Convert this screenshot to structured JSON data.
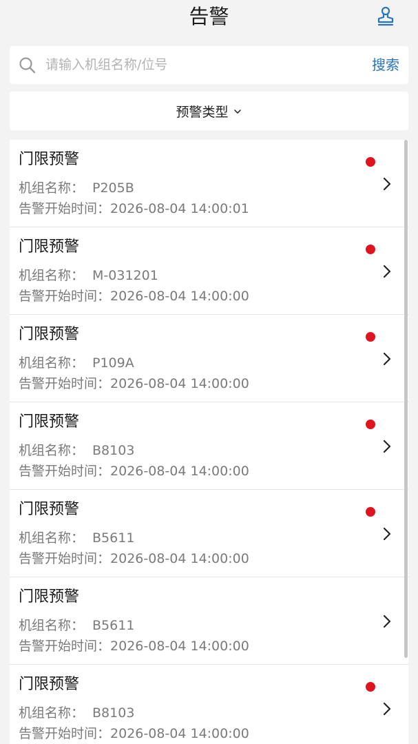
{
  "header": {
    "title": "告警",
    "stamp_icon": "stamp-icon"
  },
  "search": {
    "placeholder": "请输入机组名称/位号",
    "value": "",
    "button_label": "搜索",
    "icon": "search-icon"
  },
  "filter": {
    "label": "预警类型",
    "icon": "chevron-down-icon"
  },
  "colors": {
    "accent": "#2a73b9",
    "alert_dot": "#e0141e"
  },
  "alerts": [
    {
      "title": "门限预警",
      "unit_label": "机组名称：",
      "unit": "P205B",
      "time_label": "告警开始时间：",
      "time": "2026-08-04 14:00:01",
      "unread": true
    },
    {
      "title": "门限预警",
      "unit_label": "机组名称：",
      "unit": "M-031201",
      "time_label": "告警开始时间：",
      "time": "2026-08-04 14:00:00",
      "unread": true
    },
    {
      "title": "门限预警",
      "unit_label": "机组名称：",
      "unit": "P109A",
      "time_label": "告警开始时间：",
      "time": "2026-08-04 14:00:00",
      "unread": true
    },
    {
      "title": "门限预警",
      "unit_label": "机组名称：",
      "unit": "B8103",
      "time_label": "告警开始时间：",
      "time": "2026-08-04 14:00:00",
      "unread": true
    },
    {
      "title": "门限预警",
      "unit_label": "机组名称：",
      "unit": "B5611",
      "time_label": "告警开始时间：",
      "time": "2026-08-04 14:00:00",
      "unread": true
    },
    {
      "title": "门限预警",
      "unit_label": "机组名称：",
      "unit": "B5611",
      "time_label": "告警开始时间：",
      "time": "2026-08-04 14:00:00",
      "unread": false
    },
    {
      "title": "门限预警",
      "unit_label": "机组名称：",
      "unit": "B8103",
      "time_label": "告警开始时间：",
      "time": "2026-08-04 14:00:00",
      "unread": true
    }
  ]
}
